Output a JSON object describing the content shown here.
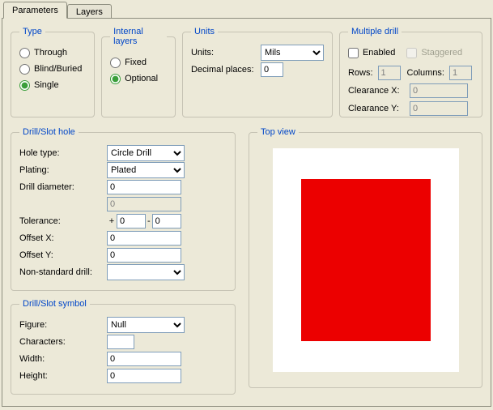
{
  "tabs": {
    "parameters": "Parameters",
    "layers": "Layers"
  },
  "type": {
    "legend": "Type",
    "through": "Through",
    "blind": "Blind/Buried",
    "single": "Single"
  },
  "internal": {
    "legend": "Internal layers",
    "fixed": "Fixed",
    "optional": "Optional"
  },
  "units": {
    "legend": "Units",
    "units_label": "Units:",
    "units_value": "Mils",
    "decimal_label": "Decimal places:",
    "decimal_value": "0"
  },
  "multi": {
    "legend": "Multiple drill",
    "enabled": "Enabled",
    "staggered": "Staggered",
    "rows": "Rows:",
    "rows_val": "1",
    "cols": "Columns:",
    "cols_val": "1",
    "cx": "Clearance X:",
    "cx_val": "0",
    "cy": "Clearance Y:",
    "cy_val": "0"
  },
  "hole": {
    "legend": "Drill/Slot hole",
    "holetype": "Hole type:",
    "holetype_val": "Circle Drill",
    "plating": "Plating:",
    "plating_val": "Plated",
    "diameter": "Drill diameter:",
    "diameter_val": "0",
    "diameter2_val": "0",
    "tolerance": "Tolerance:",
    "tol_plus": "+",
    "tol_a": "0",
    "tol_sep": "-",
    "tol_b": "0",
    "offx": "Offset X:",
    "offx_val": "0",
    "offy": "Offset Y:",
    "offy_val": "0",
    "nonstd": "Non-standard drill:",
    "nonstd_val": ""
  },
  "symbol": {
    "legend": "Drill/Slot symbol",
    "figure": "Figure:",
    "figure_val": "Null",
    "chars": "Characters:",
    "chars_val": "",
    "width": "Width:",
    "width_val": "0",
    "height": "Height:",
    "height_val": "0"
  },
  "topview": {
    "legend": "Top view"
  }
}
